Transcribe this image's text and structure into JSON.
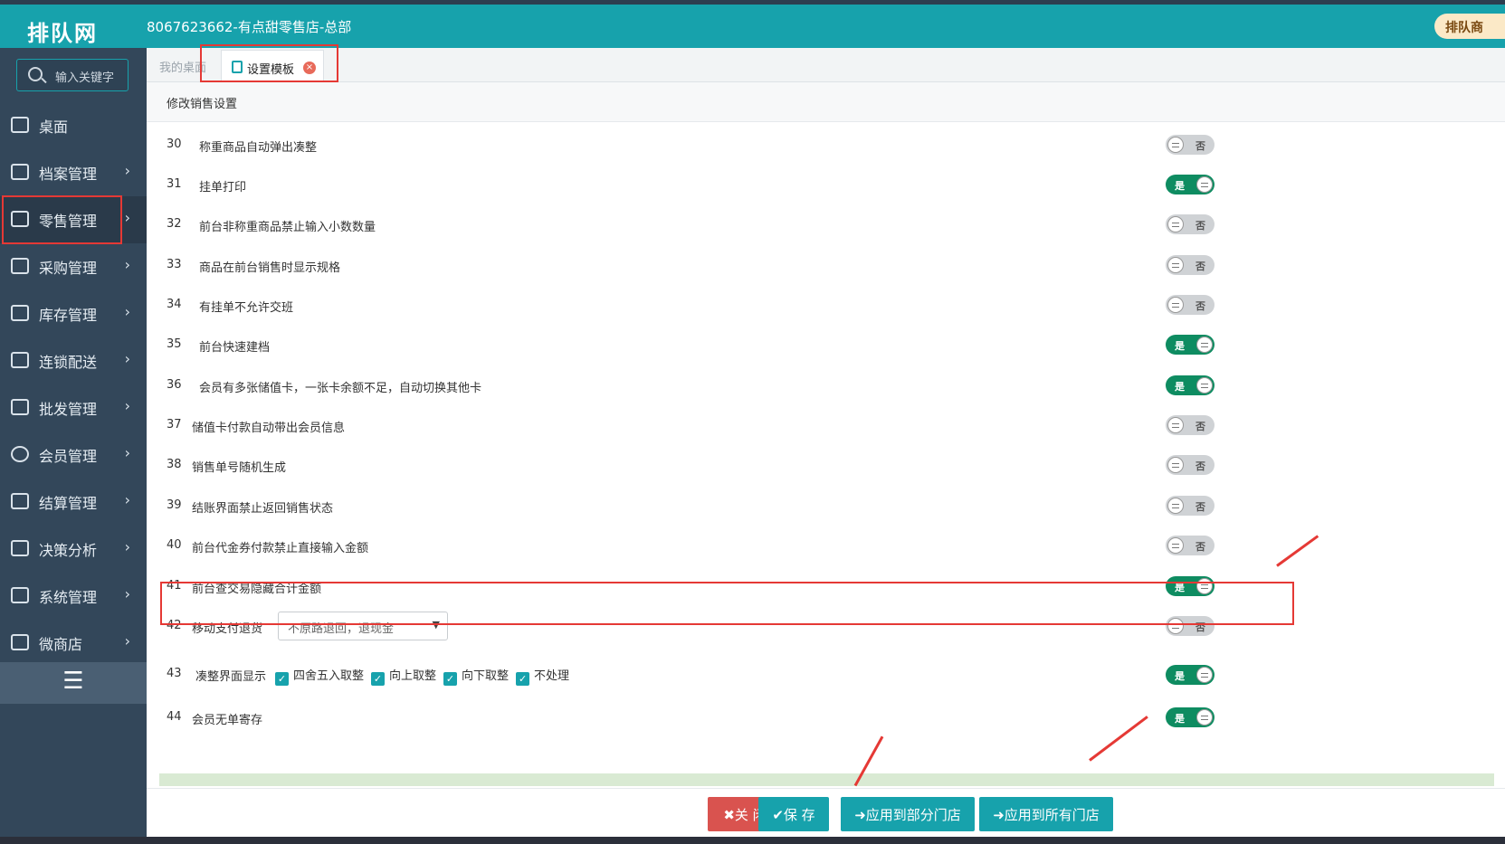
{
  "header": {
    "logo": "排队网",
    "store_title": "8067623662-有点甜零售店-总部",
    "shop_badge": "排队商"
  },
  "sidebar": {
    "search_placeholder": "输入关键字",
    "items": [
      {
        "label": "桌面",
        "icon": "monitor-icon",
        "chevron": ""
      },
      {
        "label": "档案管理",
        "icon": "archive-icon",
        "chevron": "›"
      },
      {
        "label": "零售管理",
        "icon": "store-icon",
        "chevron": "›"
      },
      {
        "label": "采购管理",
        "icon": "cart-icon",
        "chevron": "›"
      },
      {
        "label": "库存管理",
        "icon": "inventory-icon",
        "chevron": "›"
      },
      {
        "label": "连锁配送",
        "icon": "truck-icon",
        "chevron": "›"
      },
      {
        "label": "批发管理",
        "icon": "wholesale-icon",
        "chevron": "›"
      },
      {
        "label": "会员管理",
        "icon": "member-icon",
        "chevron": "›"
      },
      {
        "label": "结算管理",
        "icon": "wallet-icon",
        "chevron": "›"
      },
      {
        "label": "决策分析",
        "icon": "chart-icon",
        "chevron": "›"
      },
      {
        "label": "系统管理",
        "icon": "gear-icon",
        "chevron": "›"
      },
      {
        "label": "微商店",
        "icon": "bag-icon",
        "chevron": "›"
      }
    ],
    "collapse": "☰"
  },
  "tabs": {
    "home": "我的桌面",
    "active": "设置模板",
    "close": "×"
  },
  "section_title": "修改销售设置",
  "toggle_labels": {
    "on": "是",
    "off": "否"
  },
  "rows": [
    {
      "num": "30",
      "label": "称重商品自动弹出凑整",
      "on": false
    },
    {
      "num": "31",
      "label": "挂单打印",
      "on": true
    },
    {
      "num": "32",
      "label": "前台非称重商品禁止输入小数数量",
      "on": false
    },
    {
      "num": "33",
      "label": "商品在前台销售时显示规格",
      "on": false
    },
    {
      "num": "34",
      "label": "有挂单不允许交班",
      "on": false
    },
    {
      "num": "35",
      "label": "前台快速建档",
      "on": true
    },
    {
      "num": "36",
      "label": "会员有多张储值卡，一张卡余额不足，自动切换其他卡",
      "on": true
    },
    {
      "num": "37",
      "label": "储值卡付款自动带出会员信息",
      "on": false
    },
    {
      "num": "38",
      "label": "销售单号随机生成",
      "on": false
    },
    {
      "num": "39",
      "label": "结账界面禁止返回销售状态",
      "on": false
    },
    {
      "num": "40",
      "label": "前台代金券付款禁止直接输入金额",
      "on": false
    },
    {
      "num": "41",
      "label": "前台查交易隐藏合计金额",
      "on": true
    },
    {
      "num": "42",
      "label": "移动支付退货",
      "on": false
    },
    {
      "num": "43",
      "label": "凑整界面显示",
      "on": true
    },
    {
      "num": "44",
      "label": "会员无单寄存",
      "on": true
    }
  ],
  "row42_select": "不原路退回，退现金",
  "row43_checks": [
    "四舍五入取整",
    "向上取整",
    "向下取整",
    "不处理"
  ],
  "buttons": {
    "close": "✖关 闭",
    "save": "✔保 存",
    "apply_some": "➜应用到部分门店",
    "apply_all": "➜应用到所有门店"
  },
  "colors": {
    "accent": "#17a2ac",
    "sidebar": "#33475a",
    "toggle_on": "#0e8c61",
    "highlight": "#e53935",
    "danger": "#d9534f"
  }
}
